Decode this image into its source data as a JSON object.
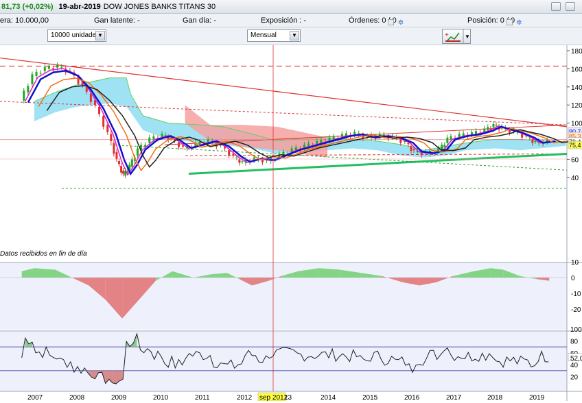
{
  "header": {
    "price_change": "81,73 (+0,02%)",
    "date": "19-abr-2019",
    "instrument": "DOW JONES BANKS TITANS 30"
  },
  "info": {
    "capital": "era: 10.000,00",
    "unrealized_label": "Gan latente:",
    "unrealized_value": "-",
    "day_gain_label": "Gan día:",
    "day_gain_value": "-",
    "exposure_label": "Exposición :",
    "exposure_value": "-",
    "orders_label": "Órdenes:",
    "orders_value": "0",
    "orders_sep": "/ 0",
    "positions_label": "Posición:",
    "positions_value": "0",
    "positions_sep": "/ 0"
  },
  "toolbar": {
    "units": "10000 unidades",
    "period": "Mensual"
  },
  "chart": {
    "data_note": "Datos recibidos en fin de día",
    "x_labels": [
      "2007",
      "2008",
      "2009",
      "2010",
      "2011",
      "2012",
      "13",
      "2014",
      "2015",
      "2016",
      "2017",
      "2018",
      "2019"
    ],
    "cursor_label": "sep 2012",
    "price_axis": [
      "180",
      "160",
      "140",
      "120",
      "100",
      "80",
      "60",
      "40"
    ],
    "price_tags": [
      "90,7",
      "85,3",
      "79,4",
      "75,4"
    ],
    "macd_axis": [
      "10",
      "0",
      "-10",
      "-20"
    ],
    "rsi_axis": [
      "100",
      "80",
      "60",
      "52,0",
      "40",
      "20"
    ],
    "colors": {
      "up": "#1faa1f",
      "down": "#e03030",
      "ma_fast": "#1010d0",
      "ma_orange": "#f07010",
      "ma_black": "#202020",
      "ma_magenta": "#e020c0",
      "cloud": "#7fd8f0",
      "cloud_red": "#f4a0a0",
      "trend_green": "#20c060"
    }
  }
}
